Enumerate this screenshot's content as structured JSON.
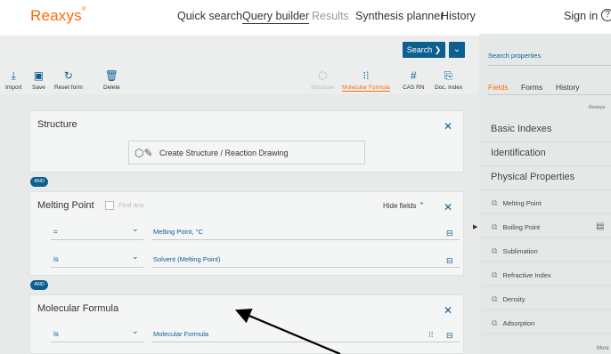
{
  "header": {
    "logo": "Reaxys",
    "logo_mark": "®",
    "nav": [
      "Quick search",
      "Query builder",
      "Results",
      "Synthesis planner",
      "History"
    ],
    "sign_in": "Sign in",
    "help": "?"
  },
  "toolbar": {
    "search_label": "Search ❯",
    "search_dropdown": "⌄",
    "tools": [
      "Import",
      "Save",
      "Reset form",
      "Delete"
    ],
    "right_tools": [
      "Structure",
      "Molecular Formula",
      "CAS RN",
      "Doc. Index"
    ]
  },
  "query": {
    "structure": {
      "title": "Structure",
      "draw_button": "Create Structure / Reaction Drawing"
    },
    "and1": "AND",
    "melting": {
      "title": "Melting Point",
      "find_any": "Find any",
      "hide_fields": "Hide fields",
      "rows": [
        {
          "operator": "=",
          "field": "Melting Point, °C"
        },
        {
          "operator": "is",
          "field": "Solvent (Melting Point)"
        }
      ]
    },
    "and2": "AND",
    "formula": {
      "title": "Molecular Formula",
      "rows": [
        {
          "operator": "is",
          "field": "Molecular Formula"
        }
      ]
    }
  },
  "sidebar": {
    "search_properties": "Search properties",
    "tabs": [
      "Fields",
      "Forms",
      "History"
    ],
    "brand": "Reaxys",
    "sections": [
      "Basic Indexes",
      "Identification",
      "Physical Properties"
    ],
    "properties": [
      "Melting Point",
      "Boiling Point",
      "Sublimation",
      "Refractive Index",
      "Density",
      "Adsorption"
    ],
    "more": "More"
  },
  "colors": {
    "accent": "#ff6c00",
    "primary": "#0d5f8f"
  }
}
